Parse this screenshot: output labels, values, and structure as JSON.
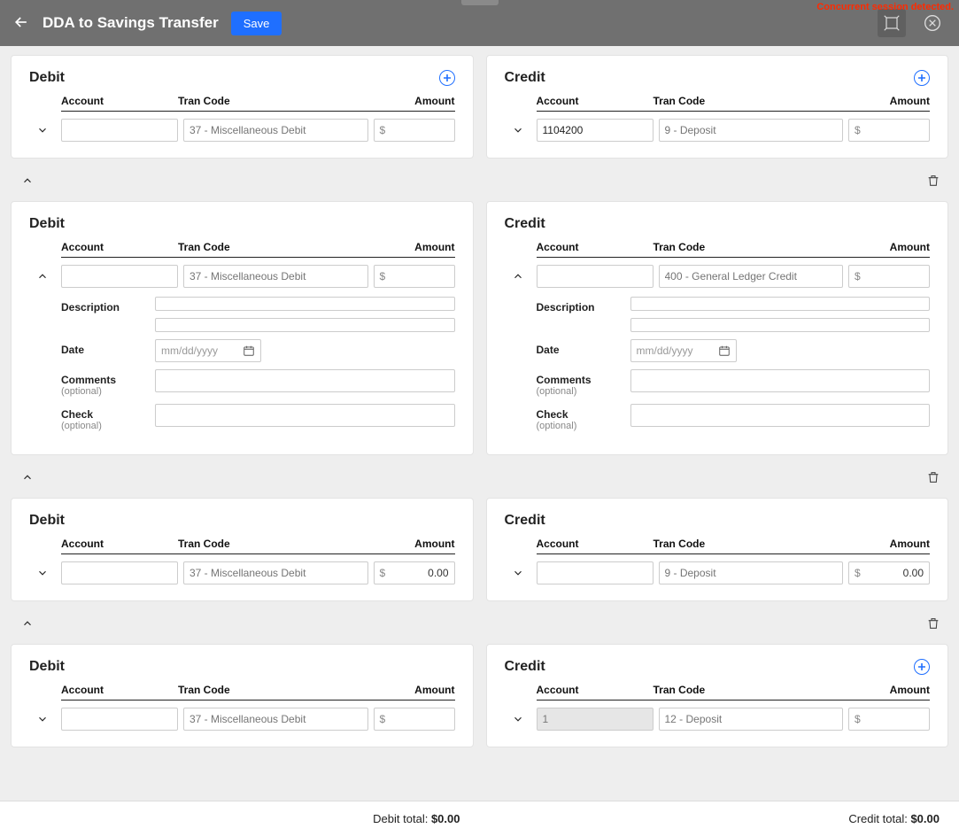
{
  "session_warning": "Concurrent session detected.",
  "topbar": {
    "title": "DDA to Savings Transfer",
    "save_label": "Save"
  },
  "headers": {
    "account": "Account",
    "tran_code": "Tran Code",
    "amount": "Amount"
  },
  "labels": {
    "debit": "Debit",
    "credit": "Credit",
    "description": "Description",
    "date": "Date",
    "comments": "Comments",
    "check": "Check",
    "optional": "(optional)",
    "date_placeholder": "mm/dd/yyyy",
    "currency": "$"
  },
  "groups": [
    {
      "debit": {
        "show_plus": true,
        "chev": "down",
        "expanded": false,
        "account": "",
        "tran_code": "37 - Miscellaneous Debit",
        "amount": ""
      },
      "credit": {
        "show_plus": true,
        "chev": "down",
        "expanded": false,
        "account": "1104200",
        "tran_code": "9 - Deposit",
        "amount": ""
      }
    },
    {
      "group_toggle": "up",
      "trash": true,
      "debit": {
        "show_plus": false,
        "chev": "up",
        "expanded": true,
        "account": "",
        "tran_code": "37 - Miscellaneous Debit",
        "amount": "",
        "description1": "",
        "description2": "",
        "date": "",
        "comments": "",
        "check": ""
      },
      "credit": {
        "show_plus": false,
        "chev": "up",
        "expanded": true,
        "account": "",
        "tran_code": "400 - General Ledger Credit",
        "amount": "",
        "description1": "",
        "description2": "",
        "date": "",
        "comments": "",
        "check": ""
      }
    },
    {
      "group_toggle": "up",
      "trash": true,
      "debit": {
        "show_plus": false,
        "chev": "down",
        "expanded": false,
        "account": "",
        "tran_code": "37 - Miscellaneous Debit",
        "amount": "0.00"
      },
      "credit": {
        "show_plus": false,
        "chev": "down",
        "expanded": false,
        "account": "",
        "tran_code": "9 - Deposit",
        "amount": "0.00"
      }
    },
    {
      "group_toggle": "up",
      "trash": true,
      "debit": {
        "show_plus": false,
        "chev": "down",
        "expanded": false,
        "account": "",
        "tran_code": "37 - Miscellaneous Debit",
        "amount": ""
      },
      "credit": {
        "show_plus": true,
        "chev": "down",
        "expanded": false,
        "account": "1",
        "account_readonly": true,
        "tran_code": "12 - Deposit",
        "amount": ""
      }
    }
  ],
  "footer": {
    "debit_label": "Debit total:",
    "debit_total": "$0.00",
    "credit_label": "Credit total:",
    "credit_total": "$0.00"
  }
}
